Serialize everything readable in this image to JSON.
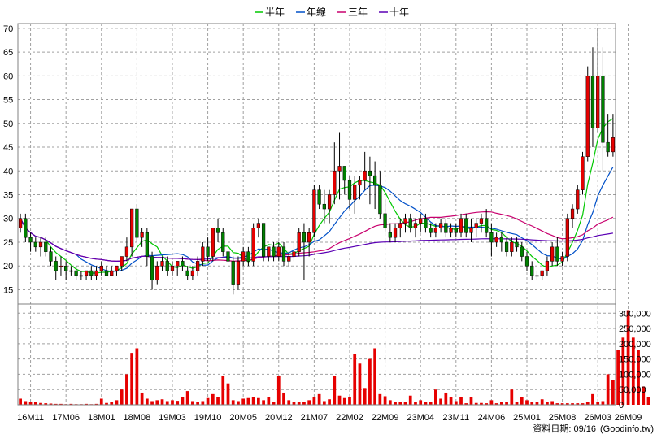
{
  "chart_data": {
    "type": "candlestick",
    "legend": {
      "placement": "top-center",
      "items": [
        {
          "name": "半年",
          "color": "#00c800"
        },
        {
          "name": "年線",
          "color": "#0050c8"
        },
        {
          "name": "三年",
          "color": "#c8006e"
        },
        {
          "name": "十年",
          "color": "#5a00b4"
        }
      ]
    },
    "grid": true,
    "colors": {
      "up": "#e60000",
      "down": "#008000",
      "volume": "#e60000",
      "wick": "#000000"
    },
    "price_axis": {
      "ylim": [
        12,
        71
      ],
      "ticks": [
        15,
        20,
        25,
        30,
        35,
        40,
        45,
        50,
        55,
        60,
        65,
        70
      ]
    },
    "volume_axis": {
      "ylim": [
        0,
        330000
      ],
      "ticks": [
        0,
        50000,
        100000,
        150000,
        200000,
        250000,
        300000
      ],
      "tick_labels": [
        "0",
        "50,000",
        "100,000",
        "150,000",
        "200,000",
        "250,000",
        "300,000"
      ]
    },
    "x_labels": [
      {
        "label": "16M11",
        "index": 2
      },
      {
        "label": "17M06",
        "index": 9
      },
      {
        "label": "18M01",
        "index": 16
      },
      {
        "label": "18M08",
        "index": 23
      },
      {
        "label": "19M03",
        "index": 30
      },
      {
        "label": "19M10",
        "index": 37
      },
      {
        "label": "20M05",
        "index": 44
      },
      {
        "label": "20M12",
        "index": 51
      },
      {
        "label": "21M07",
        "index": 58
      },
      {
        "label": "22M02",
        "index": 65
      },
      {
        "label": "22M09",
        "index": 72
      },
      {
        "label": "23M04",
        "index": 79
      },
      {
        "label": "23M11",
        "index": 86
      },
      {
        "label": "24M06",
        "index": 93
      },
      {
        "label": "25M01",
        "index": 100
      },
      {
        "label": "25M08",
        "index": 107
      },
      {
        "label": "26M03",
        "index": 114
      },
      {
        "label": "26M09",
        "index": 120
      }
    ],
    "candles": [
      [
        28,
        31,
        27,
        30
      ],
      [
        30,
        31,
        25,
        26
      ],
      [
        26,
        27,
        23,
        25
      ],
      [
        25,
        26,
        23,
        24
      ],
      [
        24,
        26,
        22,
        25
      ],
      [
        25,
        26,
        22,
        23
      ],
      [
        23,
        24,
        20,
        21
      ],
      [
        21,
        22,
        17,
        19
      ],
      [
        20,
        22,
        18,
        20
      ],
      [
        20,
        21,
        17,
        19
      ],
      [
        19,
        20,
        18,
        19
      ],
      [
        19,
        20,
        17,
        18
      ],
      [
        18,
        19,
        17,
        18
      ],
      [
        18,
        19,
        17,
        19
      ],
      [
        19,
        20,
        17,
        18
      ],
      [
        18,
        20,
        17,
        19
      ],
      [
        19,
        21,
        18,
        20
      ],
      [
        19,
        20,
        18,
        18
      ],
      [
        18,
        20,
        18,
        19
      ],
      [
        19,
        20,
        18,
        20
      ],
      [
        20,
        22,
        19,
        22
      ],
      [
        22,
        26,
        21,
        24
      ],
      [
        24,
        32,
        22,
        32
      ],
      [
        32,
        33,
        25,
        26
      ],
      [
        26,
        28,
        24,
        27
      ],
      [
        27,
        28,
        20,
        22
      ],
      [
        22,
        23,
        15,
        17
      ],
      [
        17,
        21,
        16,
        20
      ],
      [
        20,
        22,
        19,
        21
      ],
      [
        21,
        22,
        18,
        19
      ],
      [
        19,
        21,
        18,
        20
      ],
      [
        20,
        21,
        18,
        21
      ],
      [
        21,
        22,
        19,
        20
      ],
      [
        19,
        20,
        17,
        18
      ],
      [
        18,
        20,
        17,
        19
      ],
      [
        19,
        22,
        18,
        21
      ],
      [
        21,
        25,
        20,
        24
      ],
      [
        24,
        26,
        21,
        22
      ],
      [
        22,
        28,
        21,
        28
      ],
      [
        28,
        30,
        25,
        27
      ],
      [
        27,
        28,
        22,
        23
      ],
      [
        23,
        25,
        20,
        21
      ],
      [
        21,
        22,
        14,
        16
      ],
      [
        16,
        22,
        15,
        21
      ],
      [
        21,
        24,
        20,
        23
      ],
      [
        23,
        24,
        20,
        21
      ],
      [
        21,
        29,
        20,
        28
      ],
      [
        28,
        30,
        26,
        29
      ],
      [
        29,
        29,
        21,
        22
      ],
      [
        22,
        24,
        21,
        24
      ],
      [
        24,
        25,
        21,
        22
      ],
      [
        22,
        25,
        21,
        24
      ],
      [
        24,
        25,
        20,
        21
      ],
      [
        21,
        23,
        20,
        22
      ],
      [
        22,
        25,
        21,
        23
      ],
      [
        23,
        28,
        22,
        27
      ],
      [
        27,
        29,
        17,
        25
      ],
      [
        25,
        28,
        22,
        27
      ],
      [
        27,
        37,
        26,
        36
      ],
      [
        36,
        37,
        32,
        33
      ],
      [
        33,
        36,
        29,
        32
      ],
      [
        32,
        36,
        29,
        35
      ],
      [
        35,
        46,
        33,
        40
      ],
      [
        40,
        48,
        34,
        41
      ],
      [
        41,
        41,
        35,
        38
      ],
      [
        38,
        39,
        32,
        34
      ],
      [
        34,
        39,
        31,
        37
      ],
      [
        37,
        39,
        34,
        38
      ],
      [
        38,
        44,
        36,
        40
      ],
      [
        40,
        43,
        33,
        39
      ],
      [
        39,
        42,
        32,
        37
      ],
      [
        37,
        40,
        30,
        31
      ],
      [
        31,
        34,
        27,
        28
      ],
      [
        27,
        29,
        25,
        26
      ],
      [
        26,
        29,
        25,
        28
      ],
      [
        28,
        30,
        26,
        29
      ],
      [
        29,
        31,
        27,
        30
      ],
      [
        30,
        31,
        27,
        28
      ],
      [
        28,
        30,
        26,
        29
      ],
      [
        29,
        31,
        27,
        30
      ],
      [
        30,
        31,
        27,
        28
      ],
      [
        28,
        29,
        26,
        27
      ],
      [
        27,
        29,
        26,
        28
      ],
      [
        28,
        30,
        27,
        29
      ],
      [
        29,
        30,
        26,
        27
      ],
      [
        27,
        29,
        26,
        28
      ],
      [
        28,
        29,
        26,
        27
      ],
      [
        27,
        31,
        26,
        30
      ],
      [
        30,
        31,
        26,
        27
      ],
      [
        27,
        30,
        25,
        28
      ],
      [
        28,
        30,
        26,
        29
      ],
      [
        29,
        31,
        27,
        30
      ],
      [
        30,
        32,
        26,
        27
      ],
      [
        27,
        29,
        22,
        25
      ],
      [
        25,
        27,
        24,
        26
      ],
      [
        26,
        27,
        23,
        25
      ],
      [
        25,
        26,
        22,
        23
      ],
      [
        23,
        26,
        22,
        25
      ],
      [
        25,
        26,
        23,
        24
      ],
      [
        24,
        25,
        21,
        22
      ],
      [
        22,
        23,
        19,
        20
      ],
      [
        20,
        21,
        17,
        18
      ],
      [
        18,
        19,
        17,
        18
      ],
      [
        18,
        19,
        17,
        19
      ],
      [
        19,
        22,
        18,
        21
      ],
      [
        21,
        25,
        20,
        24
      ],
      [
        24,
        26,
        20,
        21
      ],
      [
        21,
        23,
        20,
        22
      ],
      [
        22,
        31,
        21,
        30
      ],
      [
        30,
        33,
        28,
        32
      ],
      [
        32,
        37,
        31,
        36
      ],
      [
        36,
        44,
        35,
        43
      ],
      [
        43,
        62,
        42,
        60
      ],
      [
        60,
        66,
        45,
        49
      ],
      [
        49,
        70,
        48,
        60
      ],
      [
        60,
        66,
        40,
        46
      ],
      [
        46,
        52,
        43,
        44
      ],
      [
        44,
        52,
        43,
        47
      ]
    ],
    "volumes": [
      20000,
      12000,
      10000,
      8000,
      6000,
      5000,
      4000,
      3000,
      3000,
      2000,
      3000,
      2000,
      2000,
      3000,
      2000,
      3000,
      20000,
      6000,
      8000,
      15000,
      50000,
      100000,
      170000,
      185000,
      40000,
      20000,
      12000,
      15000,
      18000,
      12000,
      15000,
      13000,
      25000,
      45000,
      12000,
      10000,
      12000,
      22000,
      35000,
      25000,
      95000,
      70000,
      15000,
      12000,
      20000,
      22000,
      25000,
      22000,
      15000,
      25000,
      10000,
      95000,
      40000,
      15000,
      8000,
      8000,
      8000,
      15000,
      25000,
      35000,
      12000,
      18000,
      95000,
      30000,
      22000,
      25000,
      165000,
      135000,
      55000,
      150000,
      185000,
      35000,
      28000,
      15000,
      10000,
      8000,
      8000,
      30000,
      8000,
      15000,
      8000,
      10000,
      50000,
      20000,
      40000,
      25000,
      12000,
      25000,
      5000,
      25000,
      6000,
      6000,
      5000,
      15000,
      5000,
      10000,
      8000,
      50000,
      8000,
      25000,
      15000,
      10000,
      10000,
      18000,
      10000,
      12000,
      5000,
      5000,
      5000,
      5000,
      5000,
      5000,
      10000,
      35000,
      8000,
      12000,
      100000,
      80000,
      180000,
      220000,
      310000,
      220000,
      180000,
      60000,
      25000
    ]
  },
  "footer": {
    "date_label": "資料日期: 09/16",
    "source_label": "(Goodinfo.tw)"
  }
}
